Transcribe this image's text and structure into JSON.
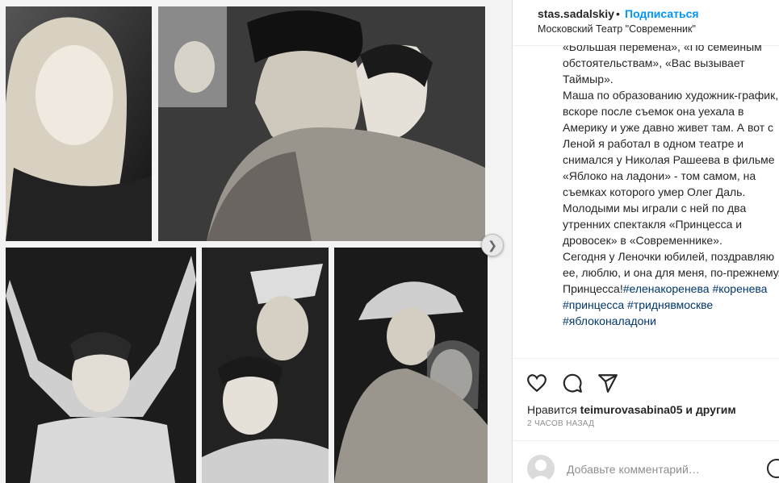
{
  "post": {
    "username": "stas.sadalskiy",
    "separator": "•",
    "follow_label": "Подписаться",
    "location": "Московский Театр \"Современник\""
  },
  "caption": {
    "lines": [
      "«Большая перемена», «По семейным обстоятельствам», «Вас вызывает Таймыр».",
      "Маша по образованию художник-график, вскоре после съемок она уехала в Америку и уже давно живет там. А вот с Леной я работал в одном театре и снимался у Николая Рашеева в фильме «Яблоко на ладони» - том самом, на съемках которого умер Олег Даль.",
      "Молодыми мы играли с ней по два утренних спектакля «Принцесса и дровосек» в «Современнике».",
      "Сегодня у Леночки юбилей, поздравляю ее, люблю, и она для меня, по-прежнему, Принцесса!"
    ],
    "hashtags": [
      "#еленакоренева",
      "#коренева",
      "#принцесса",
      "#триднявмоскве",
      "#яблоконаладони"
    ]
  },
  "likes": {
    "prefix": "Нравится",
    "user": "teimurovasabina05",
    "suffix": "и другим"
  },
  "timestamp": "2 ЧАСОВ НАЗАД",
  "comment": {
    "placeholder": "Добавьте комментарий…"
  },
  "icons": {
    "like": "heart-icon",
    "comment": "comment-icon",
    "share": "share-icon",
    "next": "chevron-right-icon",
    "emoji": "emoji-icon"
  },
  "colors": {
    "link": "#0095f6",
    "hashtag": "#00376b",
    "text": "#262626",
    "muted": "#8e8e8e"
  }
}
